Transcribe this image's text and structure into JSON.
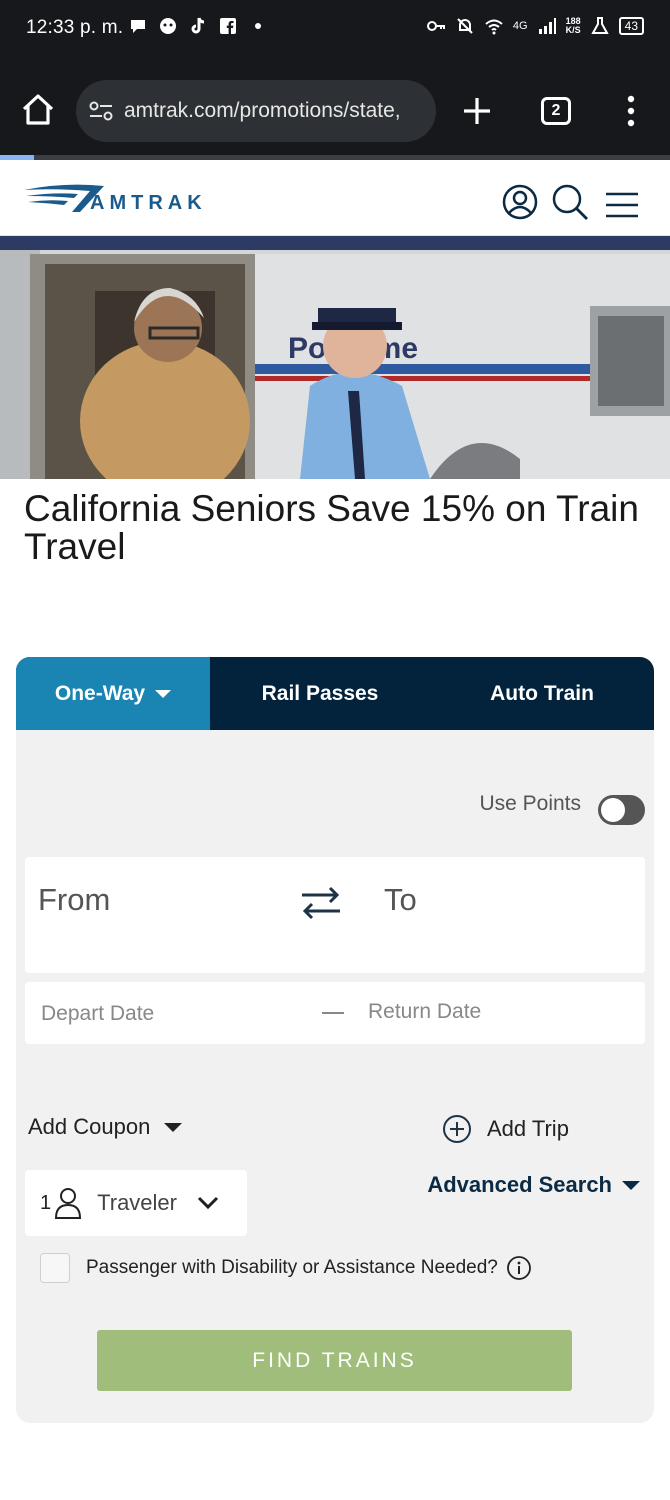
{
  "status_bar": {
    "time": "12:33 p. m.",
    "network": "4G",
    "speed_top": "188",
    "speed_bottom": "K/S",
    "battery": "43"
  },
  "browser": {
    "url": "amtrak.com/promotions/state,",
    "tab_count": "2"
  },
  "header": {
    "brand": "AMTRAK",
    "brand_color": "#1a5b8c"
  },
  "hero": {
    "train_lettering": "Po   Dume"
  },
  "page": {
    "title": "California Seniors Save 15% on Train Travel"
  },
  "booking": {
    "tabs": [
      {
        "label": "One-Way",
        "active": true
      },
      {
        "label": "Rail Passes",
        "active": false
      },
      {
        "label": "Auto Train",
        "active": false
      }
    ],
    "use_points_label": "Use Points",
    "use_points_on": false,
    "from_placeholder": "From",
    "to_placeholder": "To",
    "depart_placeholder": "Depart Date",
    "return_placeholder": "Return Date",
    "add_coupon_label": "Add Coupon",
    "add_trip_label": "Add Trip",
    "traveler_count": "1",
    "traveler_label": "Traveler",
    "advanced_search_label": "Advanced Search",
    "disability_label": "Passenger with Disability or Assistance Needed?",
    "find_trains_label": "FIND TRAINS",
    "colors": {
      "tab_bar": "#03233c",
      "active_tab": "#1a85b2",
      "find_button": "#a1bd7b"
    }
  }
}
